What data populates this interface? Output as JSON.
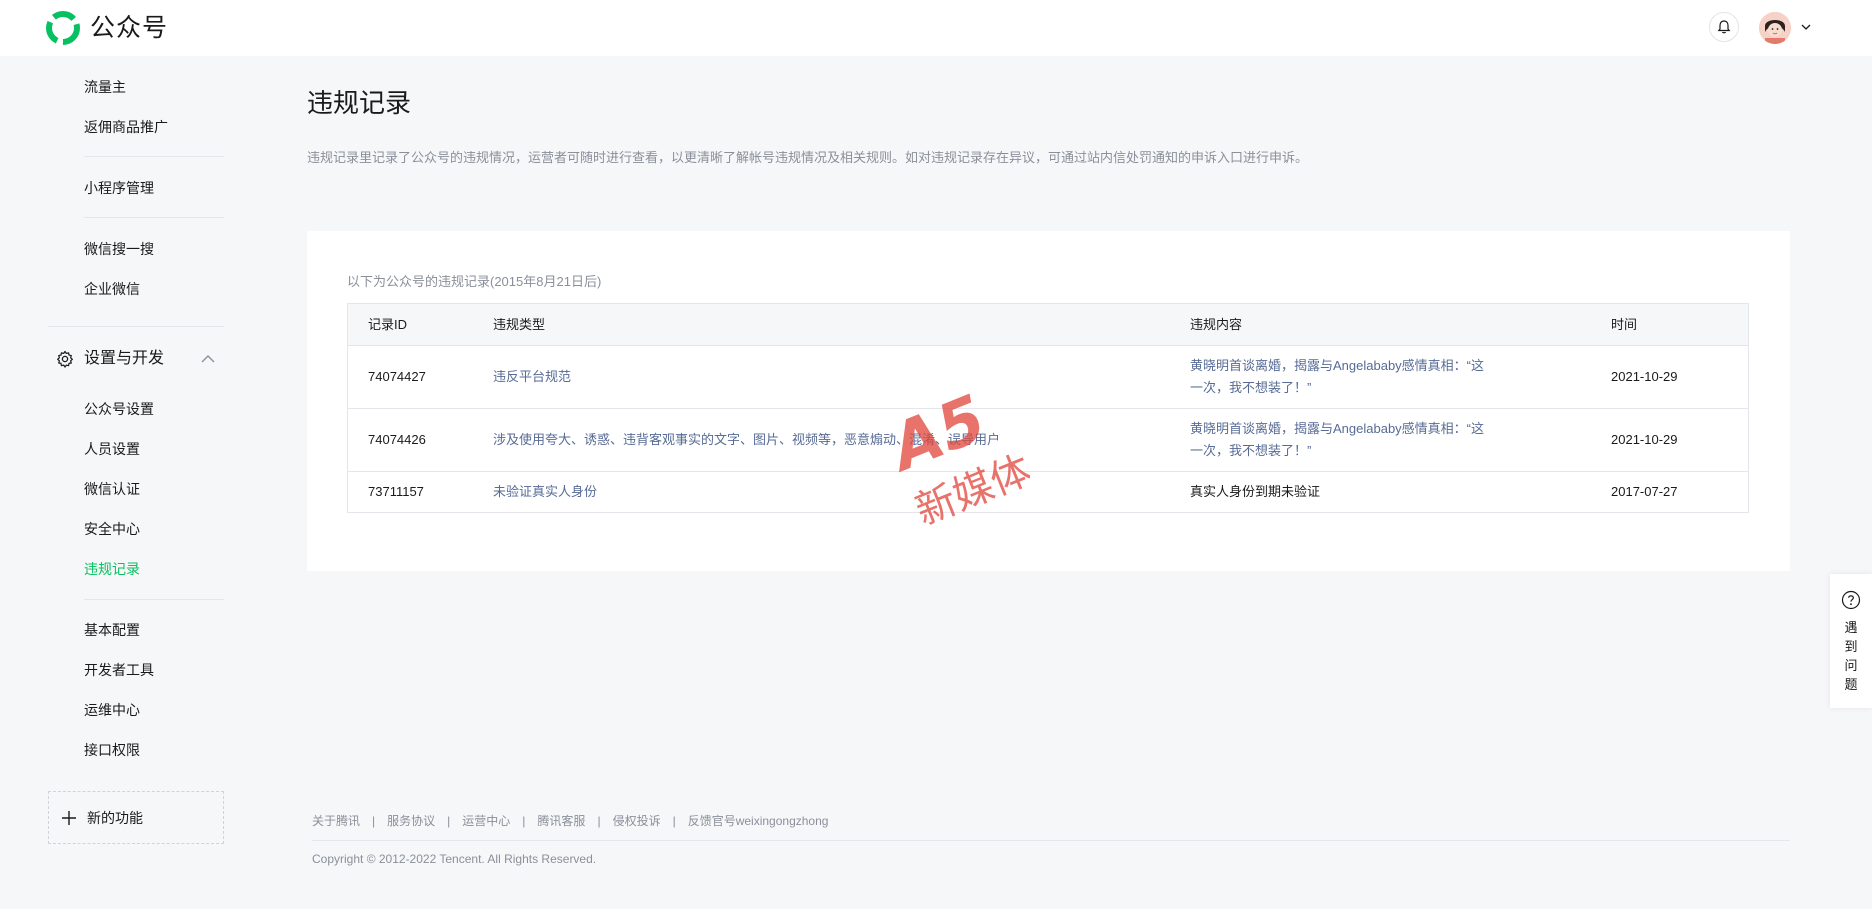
{
  "header": {
    "brand": "公众号",
    "logo_icon": "wechat-mp-logo",
    "bell_icon": "bell-icon",
    "avatar_icon": "user-avatar",
    "dropdown_icon": "chevron-down-icon"
  },
  "sidebar": {
    "items_top": [
      {
        "label": "流量主"
      },
      {
        "label": "返佣商品推广"
      },
      {
        "label": "小程序管理"
      },
      {
        "label": "微信搜一搜"
      },
      {
        "label": "企业微信"
      }
    ],
    "group": {
      "label": "设置与开发",
      "icon": "gear-icon",
      "expanded": true
    },
    "group_items": [
      {
        "label": "公众号设置"
      },
      {
        "label": "人员设置"
      },
      {
        "label": "微信认证"
      },
      {
        "label": "安全中心"
      },
      {
        "label": "违规记录",
        "active": true
      }
    ],
    "items_bottom": [
      {
        "label": "基本配置"
      },
      {
        "label": "开发者工具"
      },
      {
        "label": "运维中心"
      },
      {
        "label": "接口权限"
      }
    ],
    "new_feature": "新的功能"
  },
  "main": {
    "title": "违规记录",
    "description": "违规记录里记录了公众号的违规情况，运营者可随时进行查看，以更清晰了解帐号违规情况及相关规则。如对违规记录存在异议，可通过站内信处罚通知的申诉入口进行申诉。",
    "caption": "以下为公众号的违规记录(2015年8月21日后)",
    "table": {
      "headers": [
        "记录ID",
        "违规类型",
        "违规内容",
        "时间"
      ],
      "rows": [
        {
          "id": "74074427",
          "type": "违反平台规范",
          "content": "黄晓明首谈离婚，揭露与Angelababy感情真相：“这一次，我不想装了！”",
          "time": "2021-10-29"
        },
        {
          "id": "74074426",
          "type": "涉及使用夸大、诱惑、违背客观事实的文字、图片、视频等，恶意煽动、混淆、误导用户",
          "content": "黄晓明首谈离婚，揭露与Angelababy感情真相：“这一次，我不想装了！”",
          "time": "2021-10-29"
        },
        {
          "id": "73711157",
          "type": "未验证真实人身份",
          "content": "真实人身份到期未验证",
          "time": "2017-07-27"
        }
      ]
    }
  },
  "watermark": {
    "line1": "A5",
    "line2": "新媒体"
  },
  "help": {
    "label": "遇到问题",
    "chars": [
      "遇",
      "到",
      "问",
      "题"
    ],
    "icon": "question-circle-icon"
  },
  "footer": {
    "links": [
      "关于腾讯",
      "服务协议",
      "运营中心",
      "腾讯客服",
      "侵权投诉",
      "反馈官号weixingongzhong"
    ],
    "separator": "|",
    "copyright": "Copyright © 2012-2022 Tencent. All Rights Reserved."
  },
  "colors": {
    "accent": "#07c160",
    "link": "#576b95",
    "muted": "#8a8f99",
    "watermark": "#e0453a"
  }
}
